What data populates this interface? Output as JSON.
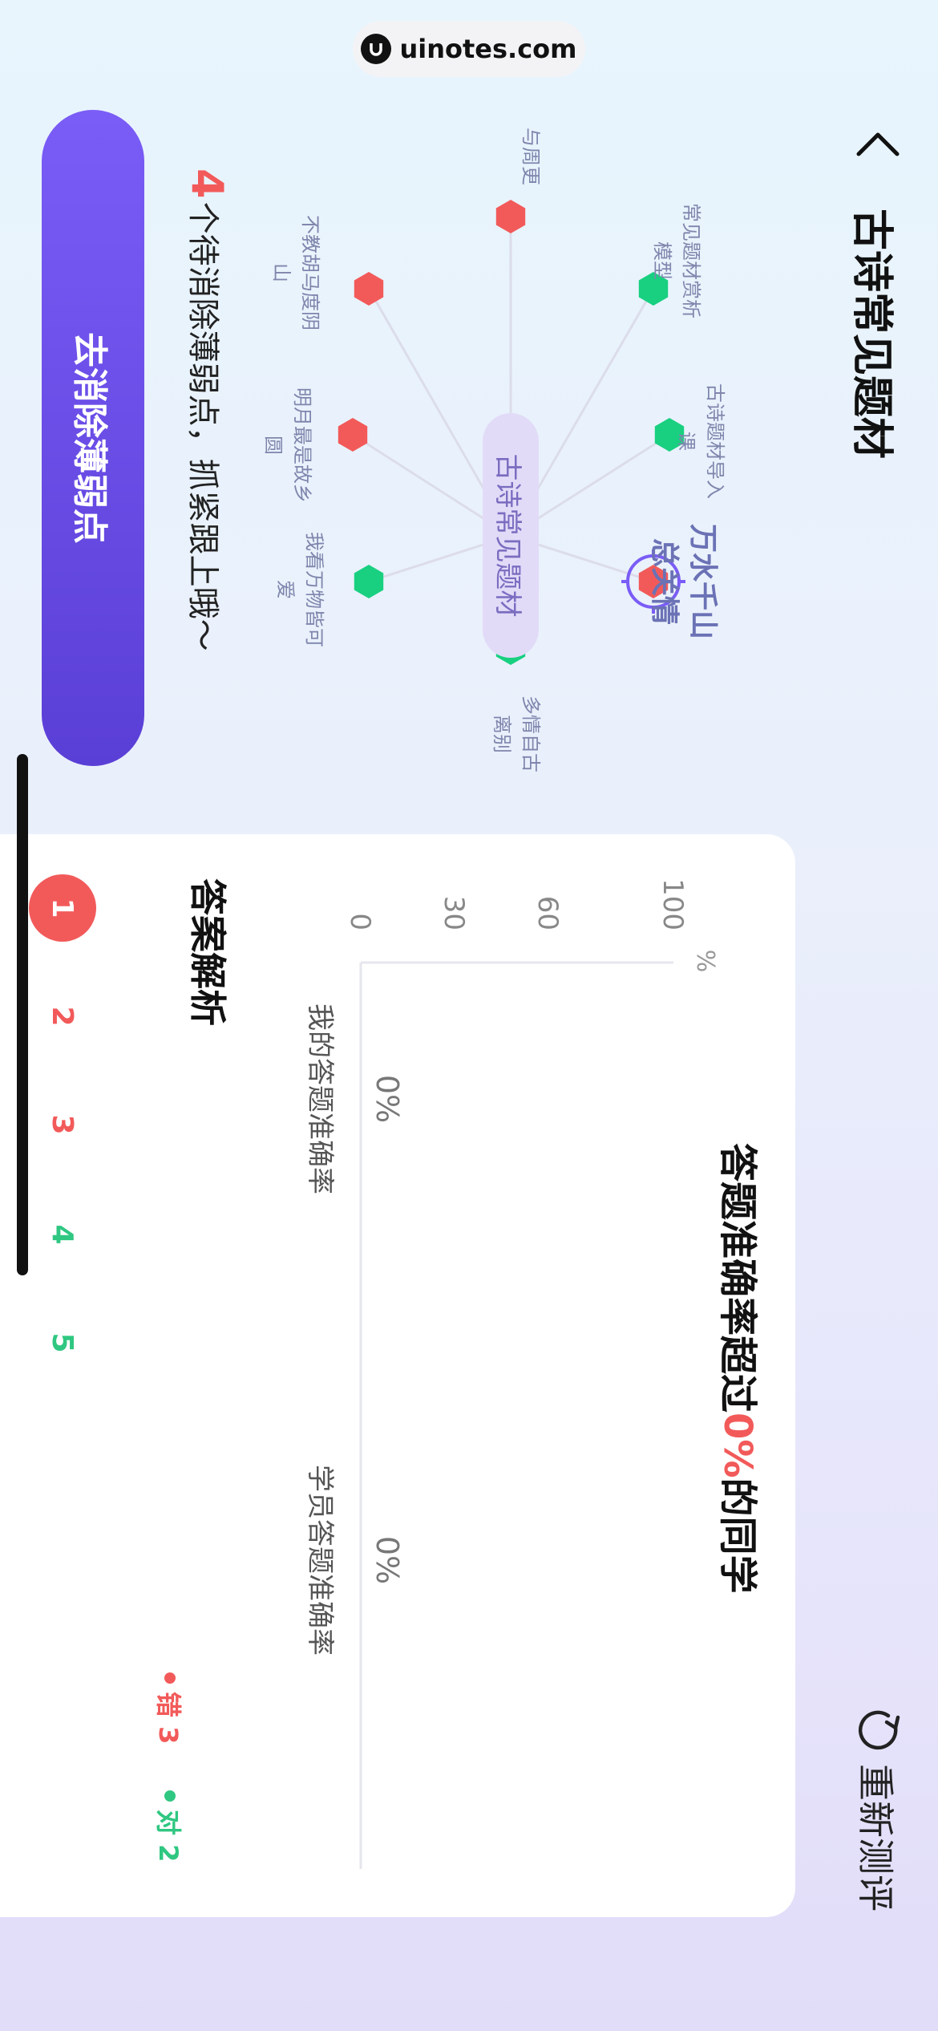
{
  "header": {
    "title": "古诗常见题材",
    "retest_label": "重新测评"
  },
  "watermark": "uinotes.com",
  "graph": {
    "center": "古诗常见题材",
    "nodes": [
      {
        "label": "常见题材赏析模型",
        "status": "right"
      },
      {
        "label": "古诗题材导入课",
        "status": "right"
      },
      {
        "label": "万水千山总关情",
        "status": "wrong",
        "active": true
      },
      {
        "label": "多情自古离别",
        "status": "right"
      },
      {
        "label": "我看万物皆可爱",
        "status": "right"
      },
      {
        "label": "明月最是故乡圆",
        "status": "wrong"
      },
      {
        "label": "不教胡马度阴山",
        "status": "wrong"
      },
      {
        "label": "与周更",
        "status": "wrong"
      }
    ],
    "colors": {
      "wrong": "#f25a5a",
      "right": "#18d080",
      "line": "#dcdcea"
    }
  },
  "weak": {
    "count": "4",
    "text": "个待消除薄弱点，抓紧跟上哦～",
    "button_label": "去消除薄弱点"
  },
  "accuracy": {
    "prefix": "答题准确率超过",
    "percent": "0%",
    "suffix": "的同学"
  },
  "chart_data": {
    "type": "bar",
    "categories": [
      "我的答题准确率",
      "学员答题准确率"
    ],
    "values": [
      0,
      0
    ],
    "value_labels": [
      "0%",
      "0%"
    ],
    "ylabel": "%",
    "yticks": [
      "0",
      "30",
      "60",
      "100"
    ],
    "ylim": [
      0,
      100
    ]
  },
  "analysis": {
    "title": "答案解析",
    "wrong_label": "错 3",
    "right_label": "对 2",
    "questions": [
      {
        "n": "1",
        "status": "active"
      },
      {
        "n": "2",
        "status": "wrong"
      },
      {
        "n": "3",
        "status": "wrong"
      },
      {
        "n": "4",
        "status": "right"
      },
      {
        "n": "5",
        "status": "right"
      }
    ]
  }
}
